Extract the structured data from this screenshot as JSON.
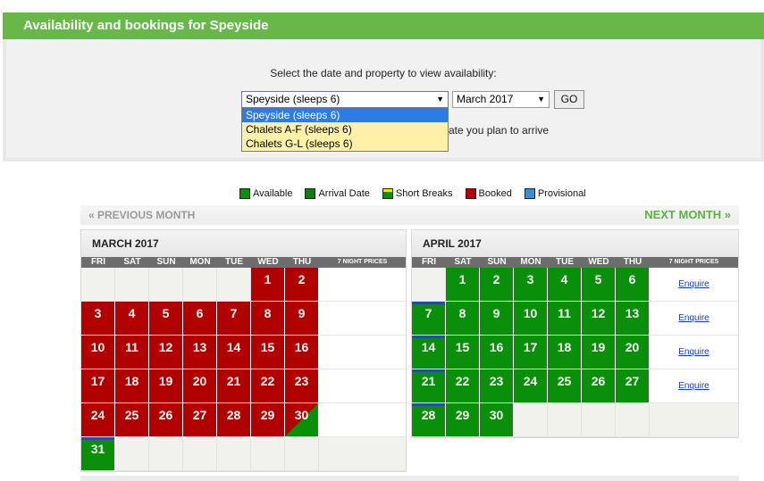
{
  "page": {
    "title": "Availability and bookings for Speyside"
  },
  "selector": {
    "prompt": "Select the date and property to view availability:",
    "property_value": "Speyside (sleeps 6)",
    "month_value": "March 2017",
    "go_label": "GO",
    "hint_fragment": "ate you plan to arrive",
    "dropdown_options": [
      "Speyside (sleeps 6)",
      "Chalets A-F (sleeps 6)",
      "Chalets G-L (sleeps 6)"
    ]
  },
  "legend": [
    {
      "label": "Available",
      "color": "#0a8f0a"
    },
    {
      "label": "Arrival Date",
      "color": "#137c13"
    },
    {
      "label": "Short Breaks",
      "color": "#0a8f0a"
    },
    {
      "label": "Booked",
      "color": "#b10000"
    },
    {
      "label": "Provisional",
      "color": "#3b8fd0"
    }
  ],
  "nav": {
    "prev_label": "« PREVIOUS MONTH",
    "next_label": "NEXT MONTH »"
  },
  "weekday_headers": [
    "FRI",
    "SAT",
    "SUN",
    "MON",
    "TUE",
    "WED",
    "THU"
  ],
  "prices_header": "7 NIGHT PRICES",
  "colors": {
    "booked": "#b10000",
    "available": "#0a8f0a",
    "arrival_marker": "#2b4aa8"
  },
  "calendars": [
    {
      "title": "MARCH 2017",
      "weeks": [
        {
          "days": [
            null,
            null,
            null,
            null,
            null,
            {
              "d": "1",
              "s": "booked"
            },
            {
              "d": "2",
              "s": "booked"
            }
          ],
          "price": ""
        },
        {
          "days": [
            {
              "d": "3",
              "s": "booked"
            },
            {
              "d": "4",
              "s": "booked"
            },
            {
              "d": "5",
              "s": "booked"
            },
            {
              "d": "6",
              "s": "booked"
            },
            {
              "d": "7",
              "s": "booked"
            },
            {
              "d": "8",
              "s": "booked"
            },
            {
              "d": "9",
              "s": "booked"
            }
          ],
          "price": ""
        },
        {
          "days": [
            {
              "d": "10",
              "s": "booked"
            },
            {
              "d": "11",
              "s": "booked"
            },
            {
              "d": "12",
              "s": "booked"
            },
            {
              "d": "13",
              "s": "booked"
            },
            {
              "d": "14",
              "s": "booked"
            },
            {
              "d": "15",
              "s": "booked"
            },
            {
              "d": "16",
              "s": "booked"
            }
          ],
          "price": ""
        },
        {
          "days": [
            {
              "d": "17",
              "s": "booked"
            },
            {
              "d": "18",
              "s": "booked"
            },
            {
              "d": "19",
              "s": "booked"
            },
            {
              "d": "20",
              "s": "booked"
            },
            {
              "d": "21",
              "s": "booked"
            },
            {
              "d": "22",
              "s": "booked"
            },
            {
              "d": "23",
              "s": "booked"
            }
          ],
          "price": ""
        },
        {
          "days": [
            {
              "d": "24",
              "s": "booked"
            },
            {
              "d": "25",
              "s": "booked"
            },
            {
              "d": "26",
              "s": "booked"
            },
            {
              "d": "27",
              "s": "booked"
            },
            {
              "d": "28",
              "s": "booked"
            },
            {
              "d": "29",
              "s": "booked"
            },
            {
              "d": "30",
              "s": "split"
            }
          ],
          "price": ""
        },
        {
          "days": [
            {
              "d": "31",
              "s": "available",
              "arrival": true
            },
            null,
            null,
            null,
            null,
            null,
            null
          ],
          "price": ""
        }
      ]
    },
    {
      "title": "APRIL 2017",
      "weeks": [
        {
          "days": [
            null,
            {
              "d": "1",
              "s": "available"
            },
            {
              "d": "2",
              "s": "available"
            },
            {
              "d": "3",
              "s": "available"
            },
            {
              "d": "4",
              "s": "available"
            },
            {
              "d": "5",
              "s": "available"
            },
            {
              "d": "6",
              "s": "available"
            }
          ],
          "price": "Enquire"
        },
        {
          "days": [
            {
              "d": "7",
              "s": "available",
              "arrival": true
            },
            {
              "d": "8",
              "s": "available"
            },
            {
              "d": "9",
              "s": "available"
            },
            {
              "d": "10",
              "s": "available"
            },
            {
              "d": "11",
              "s": "available"
            },
            {
              "d": "12",
              "s": "available"
            },
            {
              "d": "13",
              "s": "available"
            }
          ],
          "price": "Enquire"
        },
        {
          "days": [
            {
              "d": "14",
              "s": "available",
              "arrival": true
            },
            {
              "d": "15",
              "s": "available"
            },
            {
              "d": "16",
              "s": "available"
            },
            {
              "d": "17",
              "s": "available"
            },
            {
              "d": "18",
              "s": "available"
            },
            {
              "d": "19",
              "s": "available"
            },
            {
              "d": "20",
              "s": "available"
            }
          ],
          "price": "Enquire"
        },
        {
          "days": [
            {
              "d": "21",
              "s": "available",
              "arrival": true
            },
            {
              "d": "22",
              "s": "available"
            },
            {
              "d": "23",
              "s": "available"
            },
            {
              "d": "24",
              "s": "available"
            },
            {
              "d": "25",
              "s": "available"
            },
            {
              "d": "26",
              "s": "available"
            },
            {
              "d": "27",
              "s": "available"
            }
          ],
          "price": "Enquire"
        },
        {
          "days": [
            {
              "d": "28",
              "s": "available",
              "arrival": true
            },
            {
              "d": "29",
              "s": "available"
            },
            {
              "d": "30",
              "s": "available"
            },
            null,
            null,
            null,
            null
          ],
          "price": ""
        }
      ]
    }
  ]
}
